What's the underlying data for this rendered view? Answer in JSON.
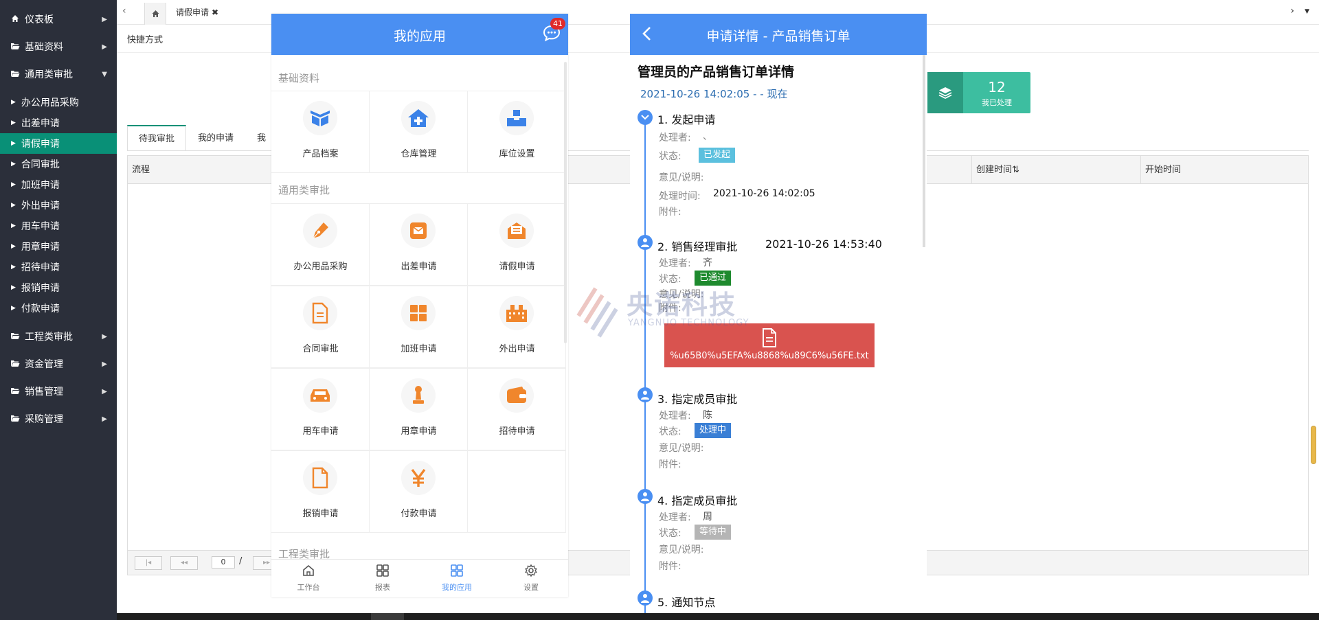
{
  "sidebar": {
    "items": [
      {
        "label": "仪表板",
        "icon": "home-icon"
      },
      {
        "label": "基础资料",
        "icon": "folder-open-icon"
      },
      {
        "label": "通用类审批",
        "icon": "folder-open-icon"
      }
    ],
    "sub_items": [
      {
        "label": "办公用品采购"
      },
      {
        "label": "出差申请"
      },
      {
        "label": "请假申请",
        "active": true
      },
      {
        "label": "合同审批"
      },
      {
        "label": "加班申请"
      },
      {
        "label": "外出申请"
      },
      {
        "label": "用车申请"
      },
      {
        "label": "用章申请"
      },
      {
        "label": "招待申请"
      },
      {
        "label": "报销申请"
      },
      {
        "label": "付款申请"
      }
    ],
    "bottom_items": [
      {
        "label": "工程类审批"
      },
      {
        "label": "资金管理"
      },
      {
        "label": "销售管理"
      },
      {
        "label": "采购管理"
      }
    ]
  },
  "topbar": {
    "back": "‹",
    "forward": "›",
    "tab_label": "请假申请",
    "tab_close": "✖"
  },
  "main": {
    "quick_title": "快捷方式",
    "tabs": [
      "待我审批",
      "我的申请",
      "我"
    ],
    "columns": {
      "flow": "流程",
      "created": "创建时间",
      "created_sort": "⇅",
      "start": "开始时间"
    },
    "pager": {
      "first": "|◂",
      "prev": "◂◂",
      "page": "0",
      "slash": "/",
      "next": "▸▸"
    },
    "stat": {
      "value": "12",
      "label": "我已处理"
    }
  },
  "phone1": {
    "title": "我的应用",
    "badge": "41",
    "sections": [
      {
        "title": "基础资料",
        "items": [
          {
            "label": "产品档案",
            "icon": "box-icon"
          },
          {
            "label": "仓库管理",
            "icon": "warehouse-icon"
          },
          {
            "label": "库位设置",
            "icon": "cubes-icon"
          }
        ]
      },
      {
        "title": "通用类审批",
        "items": [
          {
            "label": "办公用品采购",
            "icon": "pen-icon"
          },
          {
            "label": "出差申请",
            "icon": "envelope-icon"
          },
          {
            "label": "请假申请",
            "icon": "mail-open-icon"
          },
          {
            "label": "合同审批",
            "icon": "document-icon"
          },
          {
            "label": "加班申请",
            "icon": "grid-icon"
          },
          {
            "label": "外出申请",
            "icon": "building-icon"
          },
          {
            "label": "用车申请",
            "icon": "car-icon"
          },
          {
            "label": "用章申请",
            "icon": "stamp-icon"
          },
          {
            "label": "招待申请",
            "icon": "wallet-icon"
          },
          {
            "label": "报销申请",
            "icon": "file-icon"
          },
          {
            "label": "付款申请",
            "icon": "yen-icon"
          }
        ]
      },
      {
        "title": "工程类审批"
      }
    ],
    "nav": [
      {
        "label": "工作台",
        "icon": "home-outline-icon"
      },
      {
        "label": "报表",
        "icon": "grid-outline-icon"
      },
      {
        "label": "我的应用",
        "icon": "apps-icon",
        "active": true
      },
      {
        "label": "设置",
        "icon": "gear-icon"
      }
    ],
    "accent": "#4a8ff2",
    "icon_color": "#f0862c"
  },
  "phone2": {
    "title": "申请详情 - 产品销售订单",
    "heading": "管理员的产品销售订单详情",
    "timespan": "2021-10-26 14:02:05 - - 现在",
    "steps": [
      {
        "title": "1. 发起申请",
        "handler": "、",
        "status": "已发起",
        "status_color": "#5bc0de",
        "time_label": "处理时间:",
        "time": "2021-10-26 14:02:05"
      },
      {
        "title": "2. 销售经理审批",
        "time": "2021-10-26 14:53:40",
        "handler": "齐",
        "status": "已通过",
        "status_color": "#1e8a2e",
        "attachment": "%u65B0%u5EFA%u8868%u89C6%u56FE.txt"
      },
      {
        "title": "3. 指定成员审批",
        "handler": "陈",
        "status": "处理中",
        "status_color": "#3a7fd5"
      },
      {
        "title": "4. 指定成员审批",
        "handler": "周",
        "status": "等待中",
        "status_color": "#b5b5b5"
      },
      {
        "title": "5. 通知节点"
      }
    ],
    "labels": {
      "handler": "处理者:",
      "status": "状态:",
      "opinion": "意见/说明:",
      "attachments": "附件:"
    }
  },
  "watermark": {
    "cn": "央诺科技",
    "en": "YANGNUO TECHNOLOGY"
  }
}
